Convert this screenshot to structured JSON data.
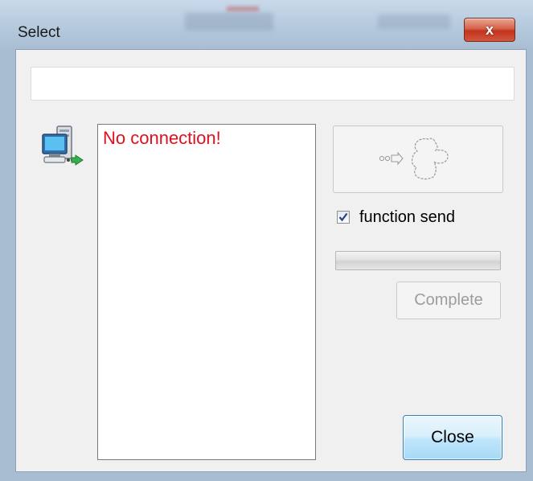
{
  "window": {
    "title": "Select",
    "close_glyph": "x"
  },
  "top_field": {
    "value": ""
  },
  "icons": {
    "connection": "network-computer-icon",
    "robot_send": "robot-send-icon"
  },
  "device_list": {
    "message": "No connection!",
    "message_color": "#e0101e"
  },
  "function_send": {
    "label": "function send",
    "checked": true
  },
  "progress": {
    "value": 0
  },
  "buttons": {
    "complete_label": "Complete",
    "close_label": "Close"
  },
  "colors": {
    "accent_blue": "#3c7fb1",
    "close_red": "#c2331d"
  }
}
